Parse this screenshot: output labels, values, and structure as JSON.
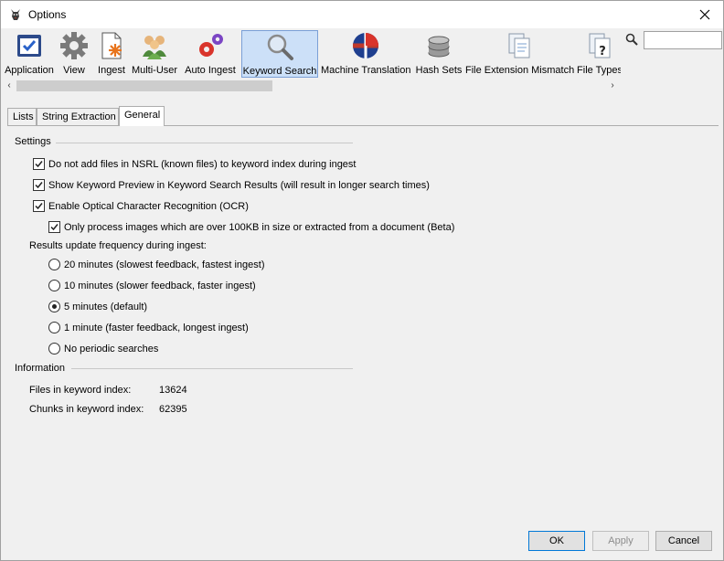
{
  "window": {
    "title": "Options"
  },
  "toolbar": {
    "items": [
      {
        "label": "Application",
        "icon": "application-icon"
      },
      {
        "label": "View",
        "icon": "gear-icon"
      },
      {
        "label": "Ingest",
        "icon": "ingest-icon"
      },
      {
        "label": "Multi-User",
        "icon": "users-icon"
      },
      {
        "label": "Auto Ingest",
        "icon": "auto-ingest-gears-icon"
      },
      {
        "label": "Keyword Search",
        "icon": "magnifier-icon",
        "selected": true
      },
      {
        "label": "Machine Translation",
        "icon": "globe-flags-icon"
      },
      {
        "label": "Hash Sets",
        "icon": "database-icon"
      },
      {
        "label": "File Extension Mismatch",
        "icon": "documents-icon"
      },
      {
        "label": "File Types",
        "icon": "file-question-icon"
      }
    ],
    "search_value": ""
  },
  "tabs": [
    {
      "label": "Lists"
    },
    {
      "label": "String Extraction"
    },
    {
      "label": "General",
      "active": true
    }
  ],
  "settings": {
    "heading": "Settings",
    "checkboxes": [
      {
        "label": "Do not add files in NSRL (known files) to keyword index during ingest",
        "checked": true
      },
      {
        "label": "Show Keyword Preview in Keyword Search Results (will result in longer search times)",
        "checked": true
      },
      {
        "label": "Enable Optical Character Recognition (OCR)",
        "checked": true
      },
      {
        "label": "Only process images which are over 100KB in size or extracted from a document (Beta)",
        "checked": true
      }
    ],
    "frequency_label": "Results update frequency during ingest:",
    "radios": [
      {
        "label": "20 minutes (slowest feedback, fastest ingest)",
        "selected": false
      },
      {
        "label": "10 minutes (slower feedback, faster ingest)",
        "selected": false
      },
      {
        "label": "5 minutes (default)",
        "selected": true
      },
      {
        "label": "1 minute (faster feedback, longest ingest)",
        "selected": false
      },
      {
        "label": "No periodic searches",
        "selected": false
      }
    ]
  },
  "information": {
    "heading": "Information",
    "files_label": "Files in keyword index:",
    "files_value": "13624",
    "chunks_label": "Chunks in keyword index:",
    "chunks_value": "62395"
  },
  "buttons": {
    "ok": "OK",
    "apply": "Apply",
    "cancel": "Cancel"
  }
}
